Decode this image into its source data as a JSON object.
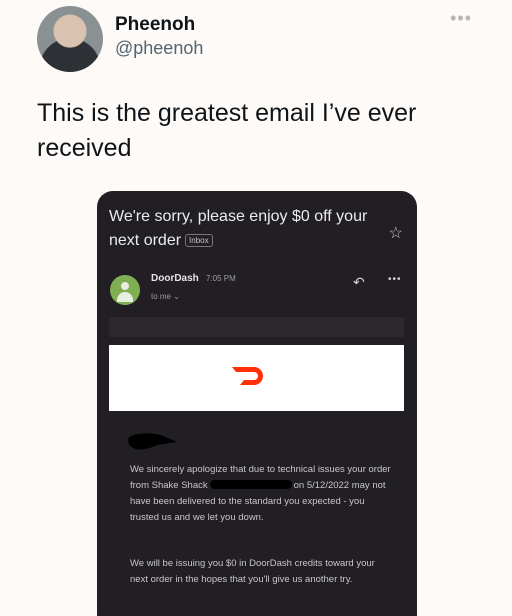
{
  "tweet": {
    "display_name": "Pheenoh",
    "handle": "@pheenoh",
    "more_icon": "•••",
    "text": "This is the greatest email I’ve ever received"
  },
  "email": {
    "subject": "We're sorry, please enjoy $0 off your next order",
    "label": "Inbox",
    "star_icon": "☆",
    "sender": "DoorDash",
    "time": "7:05 PM",
    "recipient": "to me ⌄",
    "reply_icon": "↶",
    "more_icon": "•••",
    "brand_color": "#ff3008",
    "paragraph1_before": "We sincerely apologize that due to technical issues your order from Shake Shack",
    "paragraph1_after": "on 5/12/2022 may not have been delivered to the standard you expected - you trusted us and we let you down.",
    "paragraph2": "We will be issuing you $0 in DoorDash credits toward your next order in the hopes that you'll give us another try."
  }
}
